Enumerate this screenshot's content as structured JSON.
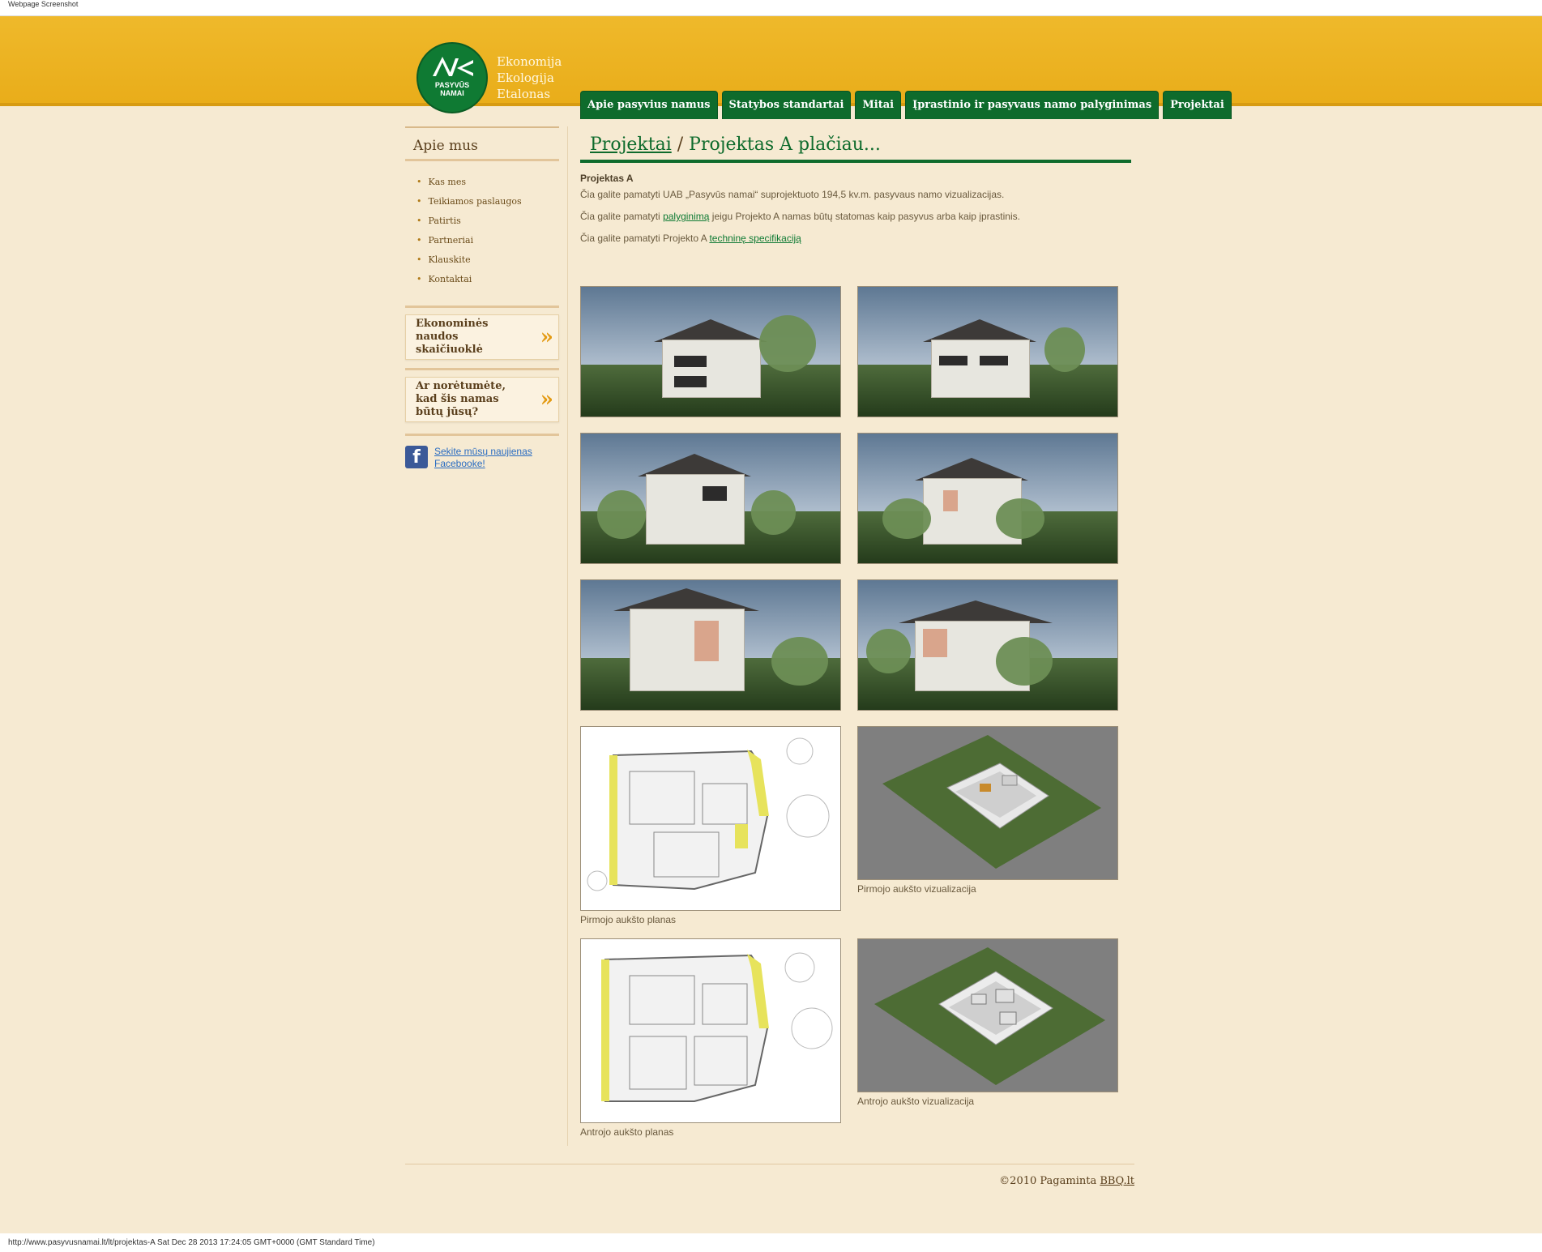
{
  "window": {
    "top_label": "Webpage Screenshot",
    "bottom_label": "http://www.pasyvusnamai.lt/lt/projektas-A Sat Dec 28 2013 17:24:05 GMT+0000 (GMT Standard Time)"
  },
  "brand": {
    "logo_text_1": "PASYVŪS",
    "logo_text_2": "NAMAI",
    "tagline_1": "Ekonomija",
    "tagline_2": "Ekologija",
    "tagline_3": "Etalonas"
  },
  "nav": {
    "items": [
      {
        "label": "Apie pasyvius namus"
      },
      {
        "label": "Statybos standartai"
      },
      {
        "label": "Mitai"
      },
      {
        "label": "Įprastinio ir pasyvaus namo palyginimas"
      },
      {
        "label": "Projektai"
      }
    ]
  },
  "sidebar": {
    "title": "Apie mus",
    "items": [
      {
        "label": "Kas mes"
      },
      {
        "label": "Teikiamos paslaugos"
      },
      {
        "label": "Patirtis"
      },
      {
        "label": "Partneriai"
      },
      {
        "label": "Klauskite"
      },
      {
        "label": "Kontaktai"
      }
    ],
    "promo_1": "Ekonominės naudos skaičiuoklė",
    "promo_2": "Ar norėtumėte, kad šis namas būtų jūsų?",
    "facebook_link": "Sekite mūsų naujienas Facebooke!"
  },
  "main": {
    "breadcrumb_link": "Projektai",
    "breadcrumb_separator": "/",
    "breadcrumb_current": "Projektas A plačiau...",
    "subtitle": "Projektas A",
    "p1": "Čia galite pamatyti UAB „Pasyvūs namai“ suprojektuoto 194,5 kv.m. pasyvaus namo vizualizacijas.",
    "p2_before": "Čia galite pamatyti",
    "p2_link": "palyginimą",
    "p2_after": "jeigu Projekto A namas būtų statomas kaip pasyvus arba kaip įprastinis.",
    "p3_before": "Čia galite pamatyti Projekto A",
    "p3_link": "techninę specifikaciją",
    "captions": {
      "first_floor_plan": "Pirmojo aukšto planas",
      "first_floor_viz": "Pirmojo aukšto vizualizacija",
      "second_floor_plan": "Antrojo aukšto planas",
      "second_floor_viz": "Antrojo aukšto vizualizacija"
    }
  },
  "footer": {
    "text": "©2010 Pagaminta",
    "link": "BBQ.lt"
  },
  "colors": {
    "header": "#efb92b",
    "nav_green": "#0e6b2c",
    "background": "#f6ead2",
    "accent_orange": "#e39a12"
  }
}
